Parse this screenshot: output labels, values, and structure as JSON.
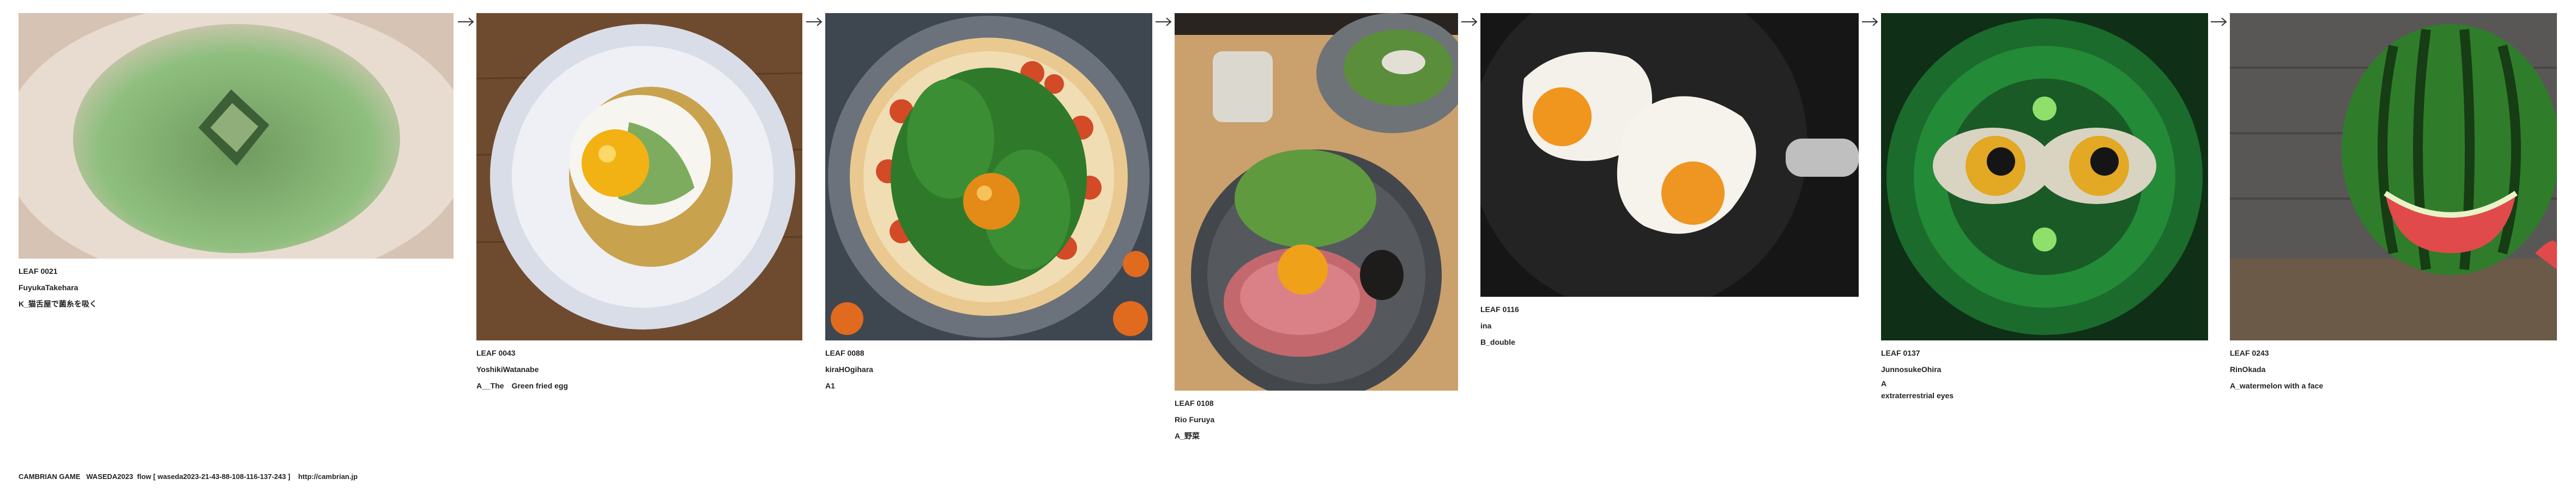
{
  "leaves": [
    {
      "id": "LEAF 0021",
      "author": "FuyukaTakehara",
      "caption": "K_猫舌屋で菌糸を吸く",
      "caption2": "",
      "image": "green-pudding-bowl"
    },
    {
      "id": "LEAF 0043",
      "author": "YoshikiWatanabe",
      "caption": "A__The　Green fried egg",
      "caption2": "",
      "image": "fried-egg-on-plate"
    },
    {
      "id": "LEAF 0088",
      "author": "kiraHOgihara",
      "caption": "A1",
      "caption2": "",
      "image": "green-pizza"
    },
    {
      "id": "LEAF 0108",
      "author": "Rio Furuya",
      "caption": "A_野菜",
      "caption2": "",
      "image": "roast-beef-salad"
    },
    {
      "id": "LEAF 0116",
      "author": "ina",
      "caption": "B_double",
      "caption2": "",
      "image": "eggs-in-pan"
    },
    {
      "id": "LEAF 0137",
      "author": "JunnosukeOhira",
      "caption": "A",
      "caption2": "extraterrestrial eyes",
      "image": "alien-eyes"
    },
    {
      "id": "LEAF 0243",
      "author": "RinOkada",
      "caption": "A_watermelon with a face",
      "caption2": "",
      "image": "watermelon-face"
    }
  ],
  "footer": {
    "text": "CAMBRIAN GAME   WASEDA2023  flow [ waseda2023-21-43-88-108-116-137-243 ]    http://cambrian.jp"
  },
  "colors": {
    "arrow": "#333333",
    "background": "#ffffff"
  }
}
